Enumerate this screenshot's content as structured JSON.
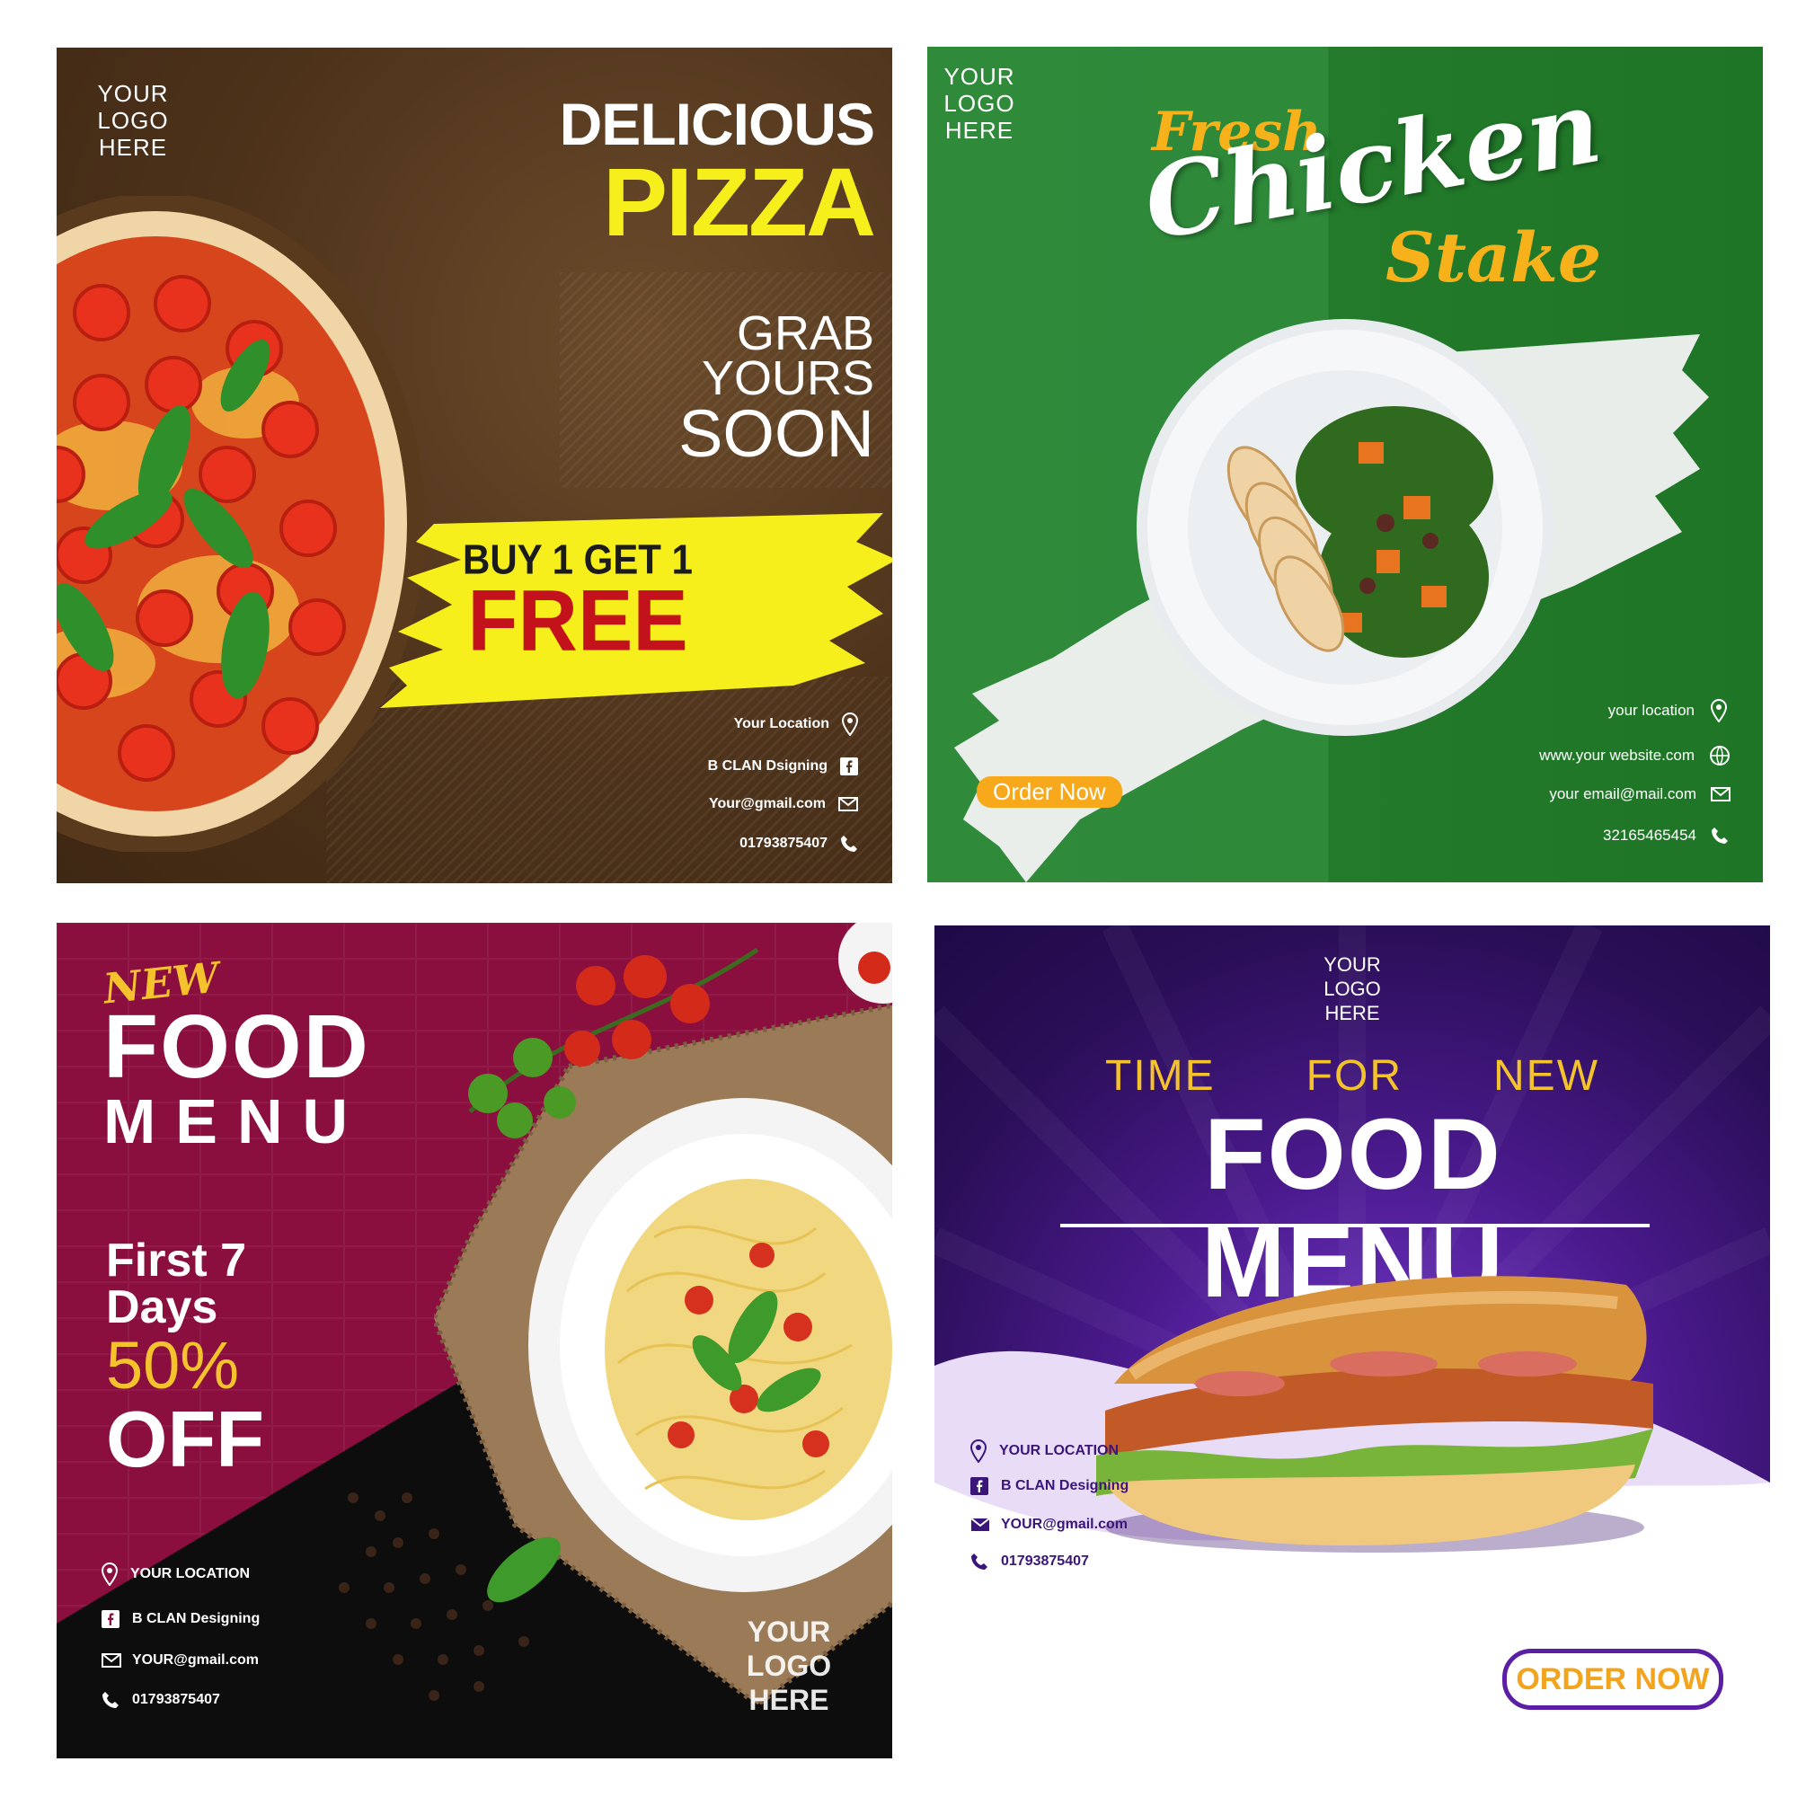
{
  "colors": {
    "pizza_bg": "#4d321a",
    "pizza_yellow": "#f7ef1c",
    "free_red": "#c3121b",
    "chicken_green": "#2e8a39",
    "order_orange": "#f7a81b",
    "pasta_magenta": "#8a0f3f",
    "food_menu_gold": "#f4c22c",
    "purple_dark": "#2a0e57",
    "order_now_purple": "#5b1fa6",
    "order_now_text": "#f2a51c"
  },
  "panels": {
    "pizza": {
      "logo": [
        "YOUR",
        "LOGO",
        "HERE"
      ],
      "title_line1": "DELICIOUS",
      "title_line2": "PIZZA",
      "tagline": [
        "GRAB",
        "YOURS",
        "SOON"
      ],
      "offer_line1": "BUY 1 GET 1",
      "offer_line2": "FREE",
      "contact": [
        {
          "text": "Your Location",
          "icon": "location-pin-icon"
        },
        {
          "text": "B CLAN Dsigning",
          "icon": "facebook-icon"
        },
        {
          "text": "Your@gmail.com",
          "icon": "mail-icon"
        },
        {
          "text": "01793875407",
          "icon": "phone-icon"
        }
      ]
    },
    "chicken": {
      "logo": [
        "YOUR",
        "LOGO",
        "HERE"
      ],
      "title_fresh": "Fresh",
      "title_chicken": "Chicken",
      "title_stake": "Stake",
      "order_button": "Order Now",
      "contact": [
        {
          "text": "your location",
          "icon": "location-pin-icon"
        },
        {
          "text": "www.your website.com",
          "icon": "globe-icon"
        },
        {
          "text": "your email@mail.com",
          "icon": "mail-icon"
        },
        {
          "text": "32165465454",
          "icon": "phone-icon"
        }
      ]
    },
    "pasta": {
      "new_label": "NEW",
      "title_food": "FOOD",
      "title_menu": "MENU",
      "offer_line1": "First 7",
      "offer_line2": "Days",
      "offer_percent": "50%",
      "offer_off": "OFF",
      "logo": [
        "YOUR",
        "LOGO",
        "HERE"
      ],
      "contact": [
        {
          "text": "YOUR LOCATION",
          "icon": "location-pin-icon"
        },
        {
          "text": "B CLAN Designing",
          "icon": "facebook-icon"
        },
        {
          "text": "YOUR@gmail.com",
          "icon": "mail-icon"
        },
        {
          "text": "01793875407",
          "icon": "phone-icon"
        }
      ]
    },
    "sandwich": {
      "logo": [
        "YOUR",
        "LOGO",
        "HERE"
      ],
      "subtitle_words": [
        "TIME",
        "FOR",
        "NEW"
      ],
      "title": "FOOD MENU",
      "order_button": "ORDER NOW",
      "contact": [
        {
          "text": "YOUR LOCATION",
          "icon": "location-pin-icon"
        },
        {
          "text": "B CLAN Designing",
          "icon": "facebook-icon"
        },
        {
          "text": "YOUR@gmail.com",
          "icon": "mail-icon"
        },
        {
          "text": "01793875407",
          "icon": "phone-icon"
        }
      ]
    }
  }
}
